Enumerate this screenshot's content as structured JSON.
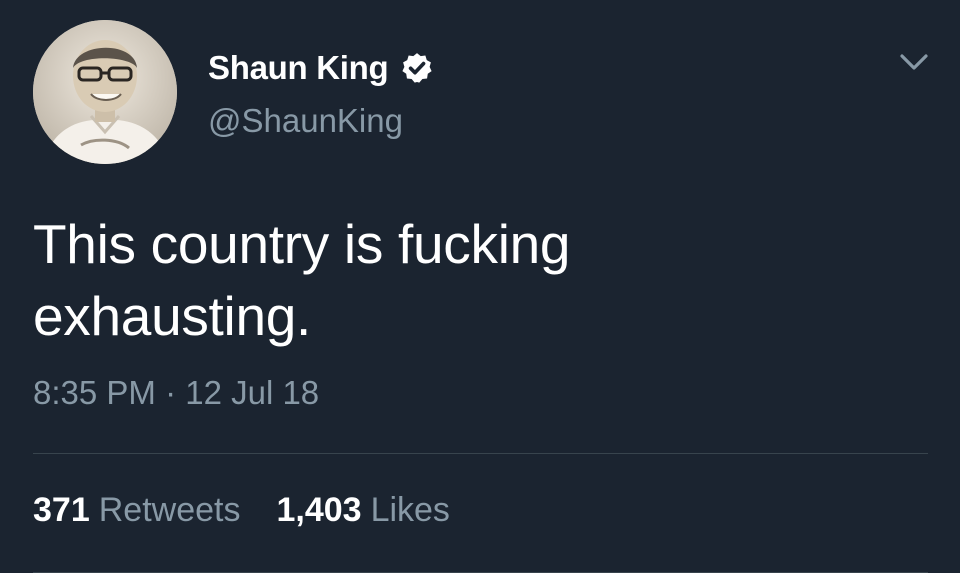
{
  "tweet": {
    "author": {
      "display_name": "Shaun King",
      "handle": "@ShaunKing",
      "verified": true,
      "avatar_icon": "profile-photo"
    },
    "text_lines": [
      "This country is fucking",
      "exhausting."
    ],
    "timestamp": "8:35 PM · 12 Jul 18",
    "stats": {
      "retweets_count": "371",
      "retweets_label": "Retweets",
      "likes_count": "1,403",
      "likes_label": "Likes"
    },
    "menu_icon": "chevron-down-icon"
  },
  "colors": {
    "background": "#1b2430",
    "primary_text": "#ffffff",
    "secondary_text": "#8899a6",
    "divider": "#38444d"
  }
}
